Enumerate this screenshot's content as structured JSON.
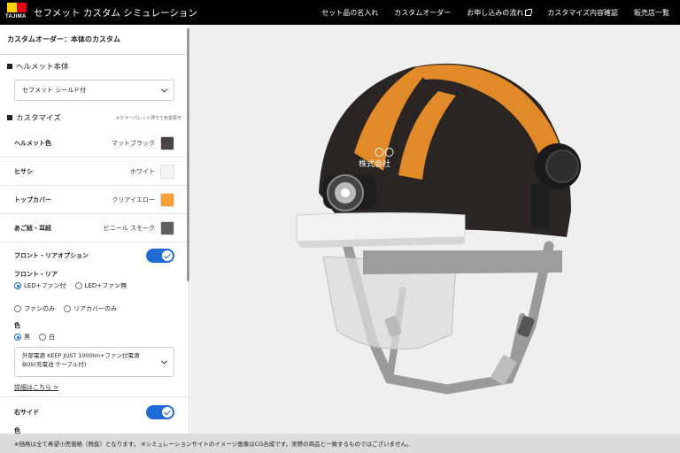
{
  "header": {
    "logo_text": "TAJIMA",
    "title": "セフメット カスタム シミュレーション",
    "nav": [
      "セット品の名入れ",
      "カスタムオーダー",
      "お申し込みの流れ",
      "カスタマイズ内容確認",
      "販売店一覧"
    ]
  },
  "panel": {
    "title": "カスタムオーダー：本体のカスタム",
    "helmet_section": "ヘルメット本体",
    "helmet_select": "セフメット シールド付",
    "customize_section": "カスタマイズ",
    "customize_note": "※カラーパレット押下で色変更可",
    "colors": [
      {
        "label": "ヘルメット色",
        "value": "マットブラック",
        "swatch": "#4a4442"
      },
      {
        "label": "ヒサシ",
        "value": "ホワイト",
        "swatch": "#f5f5f5"
      },
      {
        "label": "トップカバー",
        "value": "クリアイエロー",
        "swatch": "#f5a030"
      },
      {
        "label": "あご紐・耳紐",
        "value": "ビニール スモーク",
        "swatch": "#5f5f5f"
      }
    ],
    "front_rear_toggle_label": "フロント・リアオプション",
    "front_rear_label": "フロント・リア",
    "front_rear_options": [
      "LED+ファン付",
      "LED+ファン無",
      "ファンのみ",
      "リアカバーのみ"
    ],
    "color_label": "色",
    "color_options": [
      "黒",
      "白"
    ],
    "power_select_line1": "外部電源 KEEP JUST 1000lm+ファン付電源",
    "power_select_line2": "BOX(充電池 ケーブル付)",
    "details_link": "詳細はこちら >",
    "right_side_label": "右サイド",
    "right_side_color_label": "色"
  },
  "viewer": {
    "helmet_print": "〇〇\n株式会社",
    "colors": {
      "shell": "#2a2422",
      "top_cover": "#e08a2a",
      "visor": "#f2f2f2",
      "strap": "#8a8a8a"
    }
  },
  "footer": {
    "note": "※価格は全て希望小売価格（税抜）となります。 ※シミュレーションサイトのイメージ画像はCG合成です。実際の商品と一致するものではございません。"
  }
}
